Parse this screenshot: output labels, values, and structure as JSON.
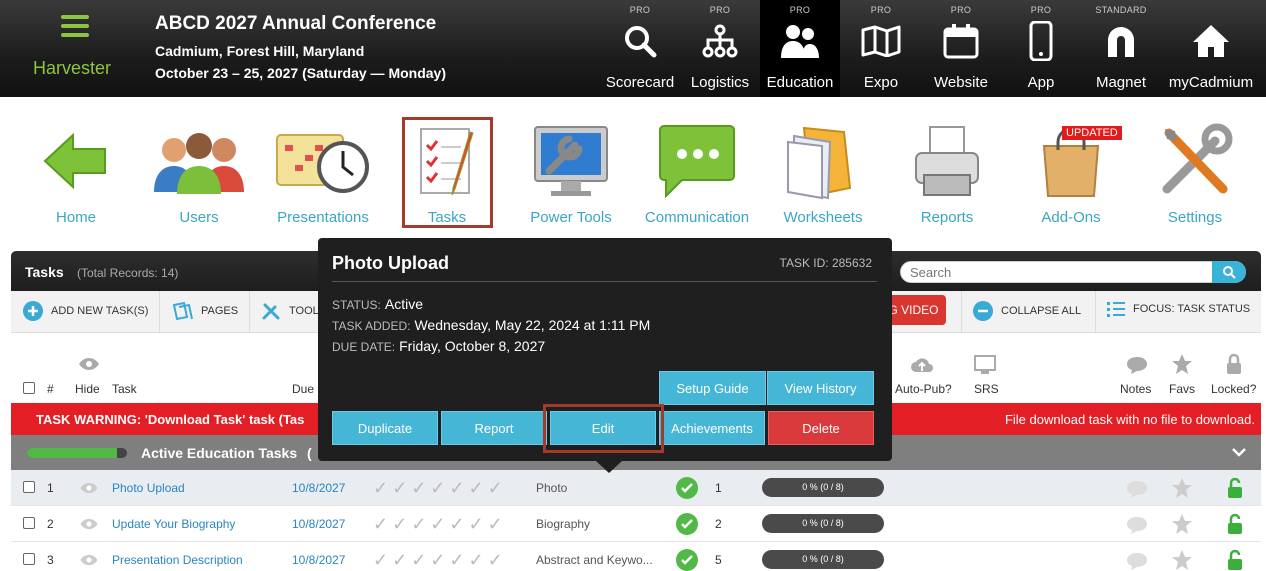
{
  "header": {
    "brand": "Harvester",
    "title": "ABCD 2027 Annual Conference",
    "location": "Cadmium, Forest Hill, Maryland",
    "dates": "October 23 – 25, 2027 (Saturday — Monday)",
    "nav": [
      {
        "tier": "PRO",
        "label": "Scorecard",
        "icon": "search-icon"
      },
      {
        "tier": "PRO",
        "label": "Logistics",
        "icon": "network-icon"
      },
      {
        "tier": "PRO",
        "label": "Education",
        "icon": "people-icon",
        "active": true
      },
      {
        "tier": "PRO",
        "label": "Expo",
        "icon": "map-icon"
      },
      {
        "tier": "PRO",
        "label": "Website",
        "icon": "calendar-icon"
      },
      {
        "tier": "PRO",
        "label": "App",
        "icon": "phone-icon"
      },
      {
        "tier": "STANDARD",
        "label": "Magnet",
        "icon": "magnet-icon"
      },
      {
        "tier": "",
        "label": "myCadmium",
        "icon": "home-icon"
      }
    ]
  },
  "apps": [
    {
      "label": "Home"
    },
    {
      "label": "Users"
    },
    {
      "label": "Presentations"
    },
    {
      "label": "Tasks",
      "selected": true
    },
    {
      "label": "Power Tools"
    },
    {
      "label": "Communication"
    },
    {
      "label": "Worksheets"
    },
    {
      "label": "Reports"
    },
    {
      "label": "Add-Ons",
      "badge": "UPDATED"
    },
    {
      "label": "Settings"
    }
  ],
  "panel": {
    "title": "Tasks",
    "count": "(Total Records: 14)",
    "search_placeholder": "Search",
    "toolbar": {
      "add": "ADD NEW TASK(S)",
      "pages": "PAGES",
      "tools": "TOOL",
      "video": "G VIDEO",
      "collapse": "COLLAPSE ALL",
      "focus": "FOCUS: TASK STATUS"
    },
    "columns": {
      "num": "#",
      "hide": "Hide",
      "task": "Task",
      "due": "Due",
      "autopub": "Auto-Pub?",
      "srs": "SRS",
      "notes": "Notes",
      "favs": "Favs",
      "locked": "Locked?"
    },
    "warning_left": "TASK WARNING: 'Download Task' task (Tas",
    "warning_right": "File download task with no file to download.",
    "group": {
      "title": "Active Education Tasks",
      "suffix": "(",
      "progress": 0.9
    },
    "rows": [
      {
        "num": "1",
        "task": "Photo Upload",
        "due": "10/8/2027",
        "type": "Photo",
        "count": "1",
        "progress": "0 % (0 / 8)"
      },
      {
        "num": "2",
        "task": "Update Your Biography",
        "due": "10/8/2027",
        "type": "Biography",
        "count": "2",
        "progress": "0 % (0 / 8)"
      },
      {
        "num": "3",
        "task": "Presentation Description",
        "due": "10/8/2027",
        "type": "Abstract and Keywo...",
        "count": "5",
        "progress": "0 % (0 / 8)"
      }
    ]
  },
  "popup": {
    "title": "Photo Upload",
    "task_id": "TASK ID: 285632",
    "status_label": "STATUS:",
    "status": "Active",
    "added_label": "TASK ADDED:",
    "added": "Wednesday, May 22, 2024 at 1:11 PM",
    "due_label": "DUE DATE:",
    "due": "Friday, October 8, 2027",
    "buttons": {
      "setup": "Setup Guide",
      "history": "View History",
      "duplicate": "Duplicate",
      "report": "Report",
      "edit": "Edit",
      "achievements": "Achievements",
      "delete": "Delete"
    }
  }
}
